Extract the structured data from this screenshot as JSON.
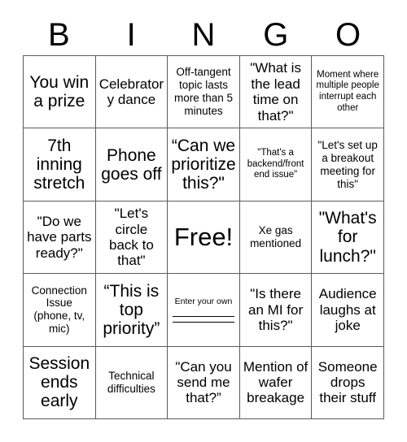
{
  "header": {
    "letters": [
      "B",
      "I",
      "N",
      "G",
      "O"
    ]
  },
  "grid": {
    "columns": 5,
    "rows": 5,
    "border_color": "#5a5a5a",
    "background": "#ffffff",
    "text_color": "#000000"
  },
  "cells": [
    {
      "text": "You win a prize",
      "size": "lg",
      "type": "text"
    },
    {
      "text": "Celebratory dance",
      "size": "md",
      "type": "text"
    },
    {
      "text": "Off-tangent topic lasts more than 5 minutes",
      "size": "sm",
      "type": "text"
    },
    {
      "text": "\"What is the lead time on that?\"",
      "size": "md",
      "type": "text"
    },
    {
      "text": "Moment where multiple people interrupt each other",
      "size": "xs",
      "type": "text"
    },
    {
      "text": "7th inning stretch",
      "size": "lg",
      "type": "text"
    },
    {
      "text": "Phone goes off",
      "size": "lg",
      "type": "text"
    },
    {
      "text": "“Can we prioritize this?\"",
      "size": "lg",
      "type": "text"
    },
    {
      "text": "\"That's a backend/front end issue\"",
      "size": "xs",
      "type": "text"
    },
    {
      "text": "\"Let's set up a breakout meeting for this\"",
      "size": "sm",
      "type": "text"
    },
    {
      "text": "\"Do we have parts ready?\"",
      "size": "md",
      "type": "text"
    },
    {
      "text": "\"Let's circle back to that\"",
      "size": "md",
      "type": "text"
    },
    {
      "text": "Free!",
      "size": "xl",
      "type": "free"
    },
    {
      "text": "Xe gas mentioned",
      "size": "sm",
      "type": "text"
    },
    {
      "text": "\"What's for lunch?\"",
      "size": "lg",
      "type": "text"
    },
    {
      "text": "Connection Issue (phone, tv, mic)",
      "size": "sm",
      "type": "text"
    },
    {
      "text": "“This is top priority”",
      "size": "lg",
      "type": "text"
    },
    {
      "text": "Enter your own",
      "size": "xs",
      "type": "write-in"
    },
    {
      "text": "\"Is there an MI for this?\"",
      "size": "md",
      "type": "text"
    },
    {
      "text": "Audience laughs at joke",
      "size": "md",
      "type": "text"
    },
    {
      "text": "Session ends early",
      "size": "lg",
      "type": "text"
    },
    {
      "text": "Technical difficulties",
      "size": "sm",
      "type": "text"
    },
    {
      "text": "\"Can you send me that?”",
      "size": "md",
      "type": "text"
    },
    {
      "text": "Mention of wafer breakage",
      "size": "md",
      "type": "text"
    },
    {
      "text": "Someone drops their stuff",
      "size": "md",
      "type": "text"
    }
  ]
}
